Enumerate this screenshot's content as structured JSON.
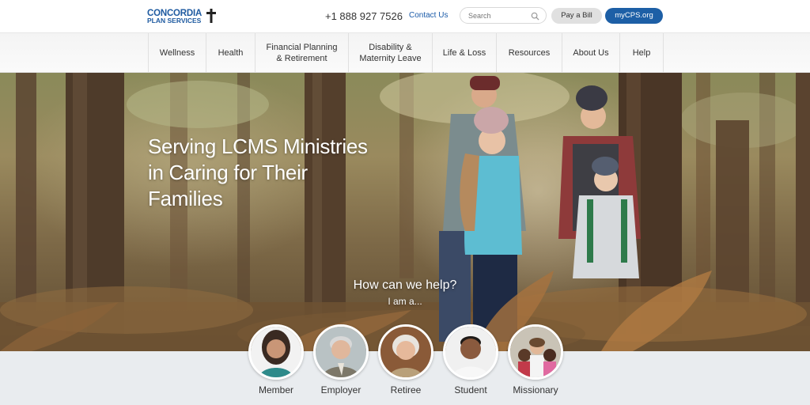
{
  "header": {
    "logo_line1": "CONCORDIA",
    "logo_line2": "PLAN SERVICES",
    "phone": "+1 888 927 7526",
    "contact_label": "Contact Us",
    "search_placeholder": "Search",
    "pay_bill_label": "Pay a Bill",
    "mycps_label": "myCPS.org"
  },
  "nav": {
    "items": [
      {
        "label": "Wellness"
      },
      {
        "label": "Health"
      },
      {
        "label": "Financial Planning\n& Retirement"
      },
      {
        "label": "Disability &\nMaternity Leave"
      },
      {
        "label": "Life & Loss"
      },
      {
        "label": "Resources"
      },
      {
        "label": "About Us"
      },
      {
        "label": "Help"
      }
    ]
  },
  "hero": {
    "headline": "Serving LCMS Ministries in Caring for Their Families",
    "question": "How can we help?",
    "subtext": "I am a..."
  },
  "personas": [
    {
      "label": "Member"
    },
    {
      "label": "Employer"
    },
    {
      "label": "Retiree"
    },
    {
      "label": "Student"
    },
    {
      "label": "Missionary"
    }
  ],
  "colors": {
    "brand_blue": "#1d5fa6",
    "logo_blue": "#1e5aa0",
    "bottom_strip": "#e9ecef"
  }
}
